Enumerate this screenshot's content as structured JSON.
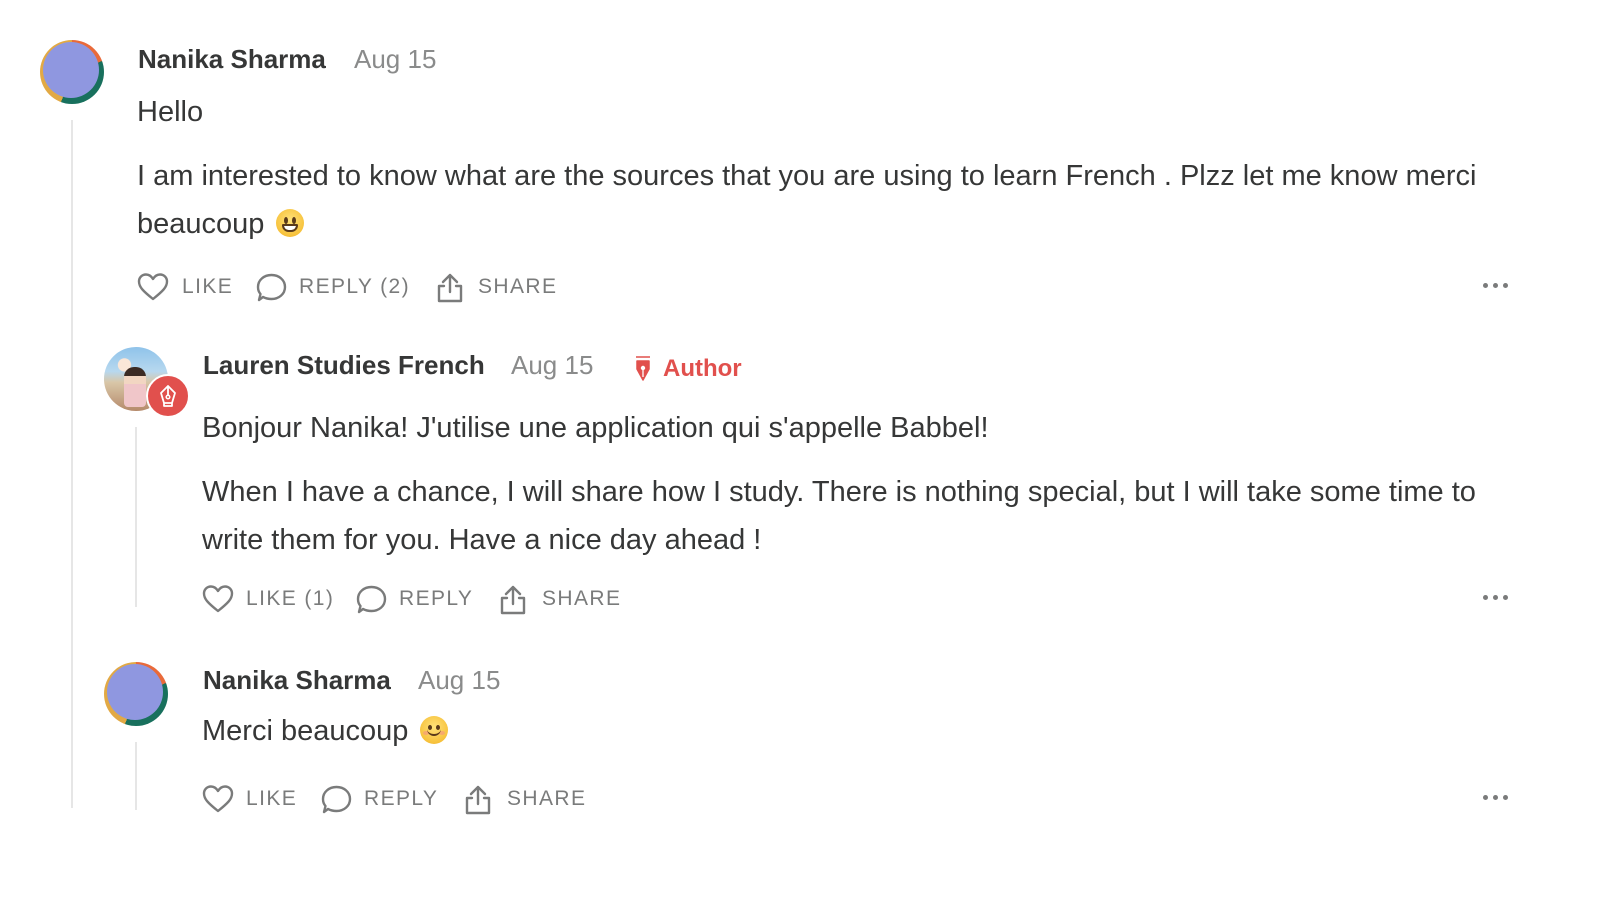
{
  "comments": [
    {
      "author": "Nanika Sharma",
      "date": "Aug 15",
      "paragraphs": [
        "Hello",
        "I am interested to know what are the sources that you are using to learn French . Plzz let me know merci beaucoup"
      ],
      "emoji": "grinning-face",
      "actions": {
        "like": "LIKE",
        "reply": "REPLY (2)",
        "share": "SHARE"
      }
    },
    {
      "author": "Lauren Studies French",
      "date": "Aug 15",
      "tag": "Author",
      "paragraphs": [
        "Bonjour Nanika! J'utilise une application qui s'appelle Babbel!",
        "When I have a chance, I will share how I study. There is nothing special, but I will take some time to write them for you. Have a nice day ahead !"
      ],
      "actions": {
        "like": "LIKE (1)",
        "reply": "REPLY",
        "share": "SHARE"
      }
    },
    {
      "author": "Nanika Sharma",
      "date": "Aug 15",
      "paragraphs": [
        "Merci beaucoup"
      ],
      "emoji": "smiling-face",
      "actions": {
        "like": "LIKE",
        "reply": "REPLY",
        "share": "SHARE"
      }
    }
  ],
  "icons": {
    "like": "heart-icon",
    "reply": "speech-bubble-icon",
    "share": "share-upload-icon",
    "more": "more-dots-icon",
    "author_badge": "pen-nib-icon"
  },
  "colors": {
    "author_accent": "#e1504d",
    "text": "#363737",
    "muted": "#8a8b8b",
    "thread_line": "#e6e6e6"
  }
}
